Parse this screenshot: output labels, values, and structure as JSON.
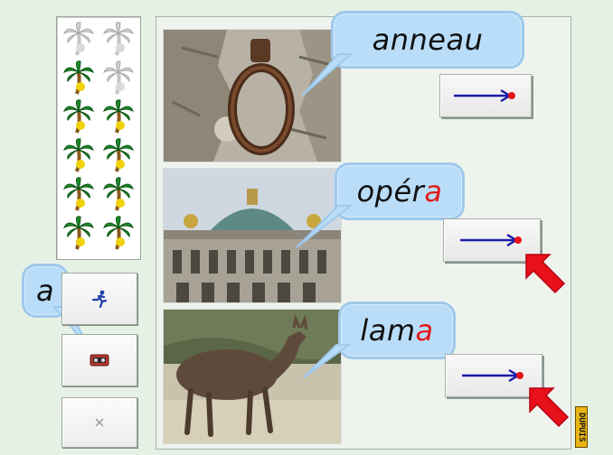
{
  "score_panel": {
    "trees": [
      {
        "state": "empty"
      },
      {
        "state": "empty"
      },
      {
        "state": "won"
      },
      {
        "state": "empty"
      },
      {
        "state": "won"
      },
      {
        "state": "won"
      },
      {
        "state": "won"
      },
      {
        "state": "won"
      },
      {
        "state": "won"
      },
      {
        "state": "won"
      },
      {
        "state": "won"
      },
      {
        "state": "won"
      }
    ]
  },
  "letter_bubble": {
    "text": "a"
  },
  "controls": {
    "run_icon": "running-man-icon",
    "sound_icon": "tape-recorder-icon",
    "close_icon": "close-icon"
  },
  "items": [
    {
      "word": "anneau",
      "word_prefix": "anneau",
      "word_highlight": "",
      "photo": "iron-ring",
      "pointer": false
    },
    {
      "word": "opéra",
      "word_prefix": "opér",
      "word_highlight": "a",
      "photo": "opera-building",
      "pointer": true
    },
    {
      "word": "lama",
      "word_prefix": "lam",
      "word_highlight": "a",
      "photo": "llama",
      "pointer": true
    }
  ],
  "badge": {
    "text": "DUPUIS"
  },
  "colors": {
    "highlight": "#e11b1b",
    "bubble": "#b9ddf9",
    "arrow": "#1a1aa8",
    "pointer": "#e8101a"
  }
}
